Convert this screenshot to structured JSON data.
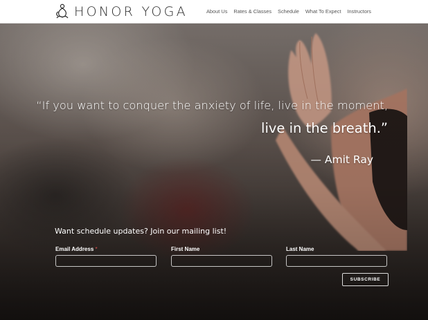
{
  "header": {
    "logo_text": "HONOR YOGA",
    "logo_icon": "yoga-lotus-figure-icon",
    "nav": [
      {
        "label": "About Us"
      },
      {
        "label": "Rates & Classes"
      },
      {
        "label": "Schedule"
      },
      {
        "label": "What To Expect"
      },
      {
        "label": "Instructors"
      }
    ]
  },
  "hero": {
    "quote_line1": "“If you want to conquer the anxiety of life, live in the moment,",
    "quote_line2": "live in the breath.”",
    "quote_author": "— Amit Ray"
  },
  "mailing": {
    "heading": "Want schedule updates? Join our mailing list!",
    "email_label": "Email Address",
    "required_marker": "*",
    "first_name_label": "First Name",
    "last_name_label": "Last Name",
    "email_value": "",
    "first_name_value": "",
    "last_name_value": "",
    "subscribe_label": "SUBSCRIBE"
  },
  "colors": {
    "header_bg": "#ffffff",
    "nav_text": "#555555",
    "logo_text": "#2b2b2b",
    "required_marker": "#e05050",
    "hero_text": "#ffffff"
  }
}
